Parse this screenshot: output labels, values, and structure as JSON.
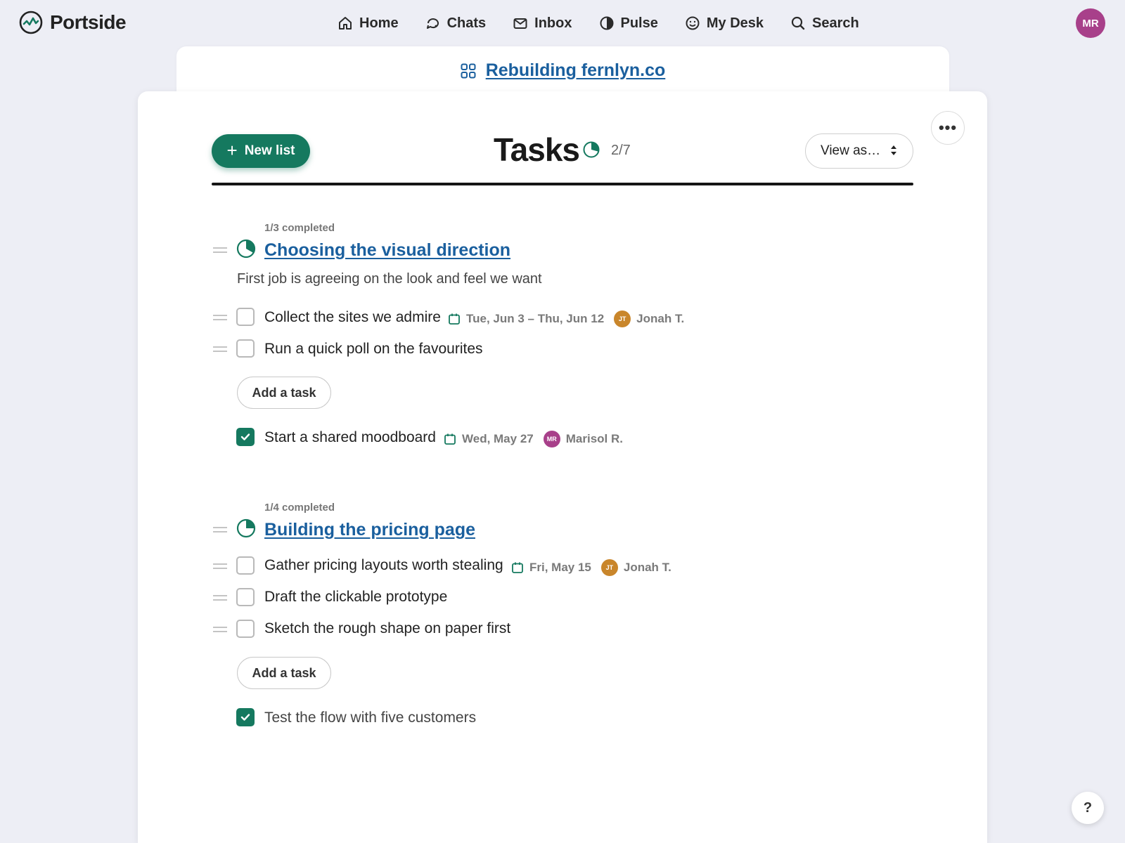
{
  "app": {
    "name": "Portside",
    "user_initials": "MR"
  },
  "nav": [
    {
      "label": "Home",
      "icon": "home-icon"
    },
    {
      "label": "Chats",
      "icon": "chat-icon"
    },
    {
      "label": "Inbox",
      "icon": "mail-icon"
    },
    {
      "label": "Pulse",
      "icon": "half-circle-icon"
    },
    {
      "label": "My Desk",
      "icon": "smiley-icon"
    },
    {
      "label": "Search",
      "icon": "search-icon"
    }
  ],
  "project": {
    "name": "Rebuilding fernlyn.co"
  },
  "toolbar": {
    "new_list_label": "New list",
    "title": "Tasks",
    "count": "2/7",
    "view_as_label": "View as…",
    "more_label": "•••"
  },
  "lists": [
    {
      "completed": "1/3 completed",
      "title": "Choosing the visual direction",
      "description": "First job is agreeing on the look and feel we want",
      "tasks": [
        {
          "text": "Collect the sites we admire",
          "done": false,
          "date": "Tue, Jun 3 – Thu, Jun 12",
          "assignee": "Jonah T.",
          "initials": "JT"
        },
        {
          "text": "Run a quick poll on the favourites",
          "done": false
        }
      ],
      "add_task_label": "Add a task",
      "done_tasks": [
        {
          "text": "Start a shared moodboard",
          "done": true,
          "date": "Wed, May 27",
          "assignee": "Marisol R.",
          "initials": "MR"
        }
      ]
    },
    {
      "completed": "1/4 completed",
      "title": "Building the pricing page",
      "tasks": [
        {
          "text": "Gather pricing layouts worth stealing",
          "done": false,
          "date": "Fri, May 15",
          "assignee": "Jonah T.",
          "initials": "JT"
        },
        {
          "text": "Draft the clickable prototype",
          "done": false
        },
        {
          "text": "Sketch the rough shape on paper first",
          "done": false
        }
      ],
      "add_task_label": "Add a task",
      "done_tasks": [
        {
          "text": "Test the flow with five customers",
          "done": true
        }
      ]
    }
  ],
  "help_label": "?",
  "colors": {
    "accent": "#15795f",
    "link": "#1a5f9e",
    "avatar_mr": "#a8408a",
    "avatar_jt": "#c9862b"
  }
}
